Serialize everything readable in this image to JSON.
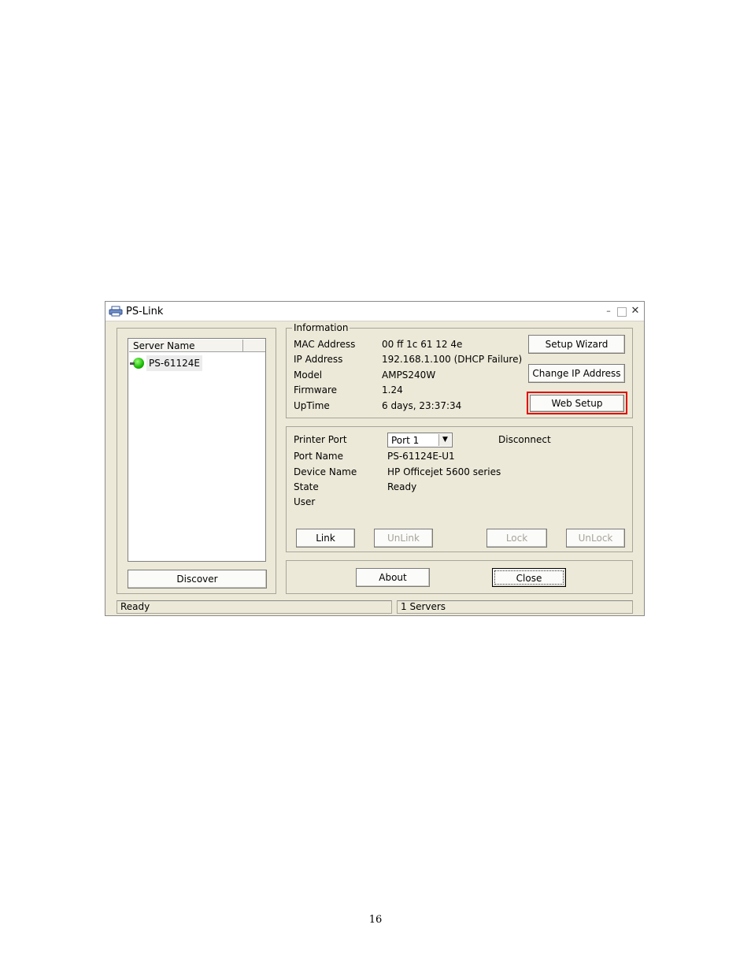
{
  "window": {
    "title": "PS-Link",
    "controls": {
      "minimize": "–",
      "maximize": "□",
      "close": "✕"
    }
  },
  "server_list": {
    "column_header": "Server Name",
    "items": [
      {
        "label": "PS-61124E",
        "icon": "green-server-icon"
      }
    ],
    "discover_label": "Discover"
  },
  "information": {
    "legend": "Information",
    "rows": [
      {
        "label": "MAC Address",
        "value": "00 ff 1c 61 12 4e"
      },
      {
        "label": "IP Address",
        "value": "192.168.1.100 (DHCP Failure)"
      },
      {
        "label": "Model",
        "value": "AMPS240W"
      },
      {
        "label": "Firmware",
        "value": "1.24"
      },
      {
        "label": "UpTime",
        "value": "6 days, 23:37:34"
      }
    ],
    "setup_wizard_label": "Setup Wizard",
    "change_ip_label": "Change IP Address",
    "web_setup_label": "Web Setup",
    "highlight_color": "#e00000"
  },
  "printer": {
    "port_label": "Printer Port",
    "port_selected": "Port 1",
    "disconnect_label": "Disconnect",
    "rows": [
      {
        "label": "Port Name",
        "value": "PS-61124E-U1"
      },
      {
        "label": "Device Name",
        "value": "HP Officejet 5600 series"
      },
      {
        "label": "State",
        "value": "Ready"
      },
      {
        "label": "User",
        "value": ""
      }
    ],
    "link_label": "Link",
    "unlink_label": "UnLink",
    "lock_label": "Lock",
    "unlock_label": "UnLock"
  },
  "footer_buttons": {
    "about_label": "About",
    "close_label": "Close"
  },
  "status": {
    "left": "Ready",
    "right": "1 Servers"
  },
  "page_number": "16"
}
